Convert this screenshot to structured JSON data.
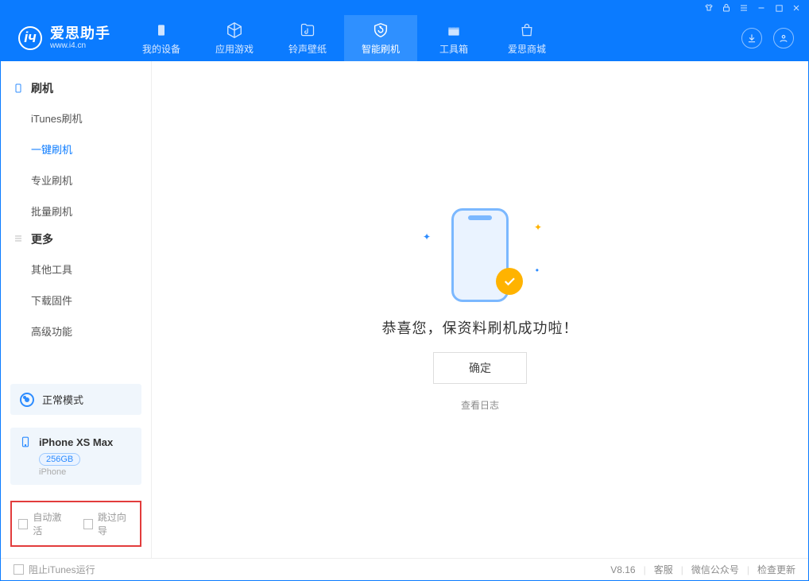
{
  "app": {
    "name": "爱思助手",
    "url": "www.i4.cn"
  },
  "nav": {
    "items": [
      {
        "label": "我的设备"
      },
      {
        "label": "应用游戏"
      },
      {
        "label": "铃声壁纸"
      },
      {
        "label": "智能刷机"
      },
      {
        "label": "工具箱"
      },
      {
        "label": "爱思商城"
      }
    ],
    "active": 3
  },
  "sidebar": {
    "groups": [
      {
        "title": "刷机",
        "items": [
          "iTunes刷机",
          "一键刷机",
          "专业刷机",
          "批量刷机"
        ],
        "active": 1
      },
      {
        "title": "更多",
        "items": [
          "其他工具",
          "下载固件",
          "高级功能"
        ],
        "active": -1
      }
    ],
    "mode": "正常模式",
    "device": {
      "name": "iPhone XS Max",
      "storage": "256GB",
      "type": "iPhone"
    },
    "checks": {
      "auto_activate": "自动激活",
      "skip_guide": "跳过向导"
    }
  },
  "main": {
    "message": "恭喜您，保资料刷机成功啦！",
    "ok": "确定",
    "view_log": "查看日志"
  },
  "footer": {
    "block_itunes": "阻止iTunes运行",
    "version": "V8.16",
    "links": [
      "客服",
      "微信公众号",
      "检查更新"
    ]
  }
}
